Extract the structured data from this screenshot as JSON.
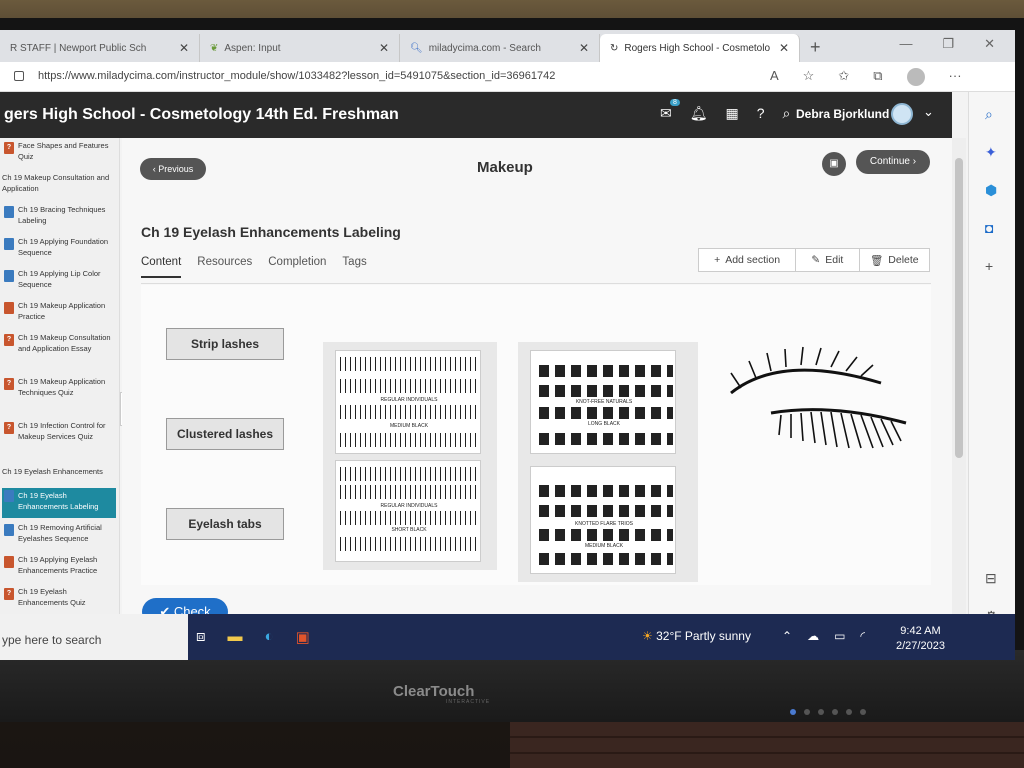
{
  "browser": {
    "tabs": [
      {
        "label": "R STAFF | Newport Public Sch"
      },
      {
        "label": "Aspen: Input"
      },
      {
        "label": "miladycima.com - Search"
      },
      {
        "label": "Rogers High School - Cosmetolo"
      }
    ],
    "url": "https://www.miladycima.com/instructor_module/show/1033482?lesson_id=5491075&section_id=36961742"
  },
  "header": {
    "title": "gers High School - Cosmetology 14th Ed. Freshman",
    "mail_badge": "8",
    "user_name": "Debra Bjorklund"
  },
  "sidebar": {
    "items": [
      {
        "label": "Face Shapes and Features Quiz",
        "icon": "quiz"
      },
      {
        "label": "Ch 19 Makeup Consultation and Application",
        "icon": "none"
      },
      {
        "label": "Ch 19 Bracing Techniques Labeling",
        "icon": "doc"
      },
      {
        "label": "Ch 19 Applying Foundation Sequence",
        "icon": "doc"
      },
      {
        "label": "Ch 19 Applying Lip Color Sequence",
        "icon": "doc"
      },
      {
        "label": "Ch 19 Makeup Application Practice",
        "icon": "practice"
      },
      {
        "label": "Ch 19 Makeup Consultation and Application Essay",
        "icon": "quiz"
      },
      {
        "label": "Ch 19 Makeup Application Techniques Quiz",
        "icon": "quiz"
      },
      {
        "label": "Ch 19 Infection Control for Makeup Services Quiz",
        "icon": "quiz"
      },
      {
        "label": "Ch 19 Eyelash Enhancements",
        "icon": "none"
      },
      {
        "label": "Ch 19 Eyelash Enhancements Labeling",
        "icon": "doc"
      },
      {
        "label": "Ch 19 Removing Artificial Eyelashes Sequence",
        "icon": "doc"
      },
      {
        "label": "Ch 19 Applying Eyelash Enhancements Practice",
        "icon": "practice"
      },
      {
        "label": "Ch 19 Eyelash Enhancements Quiz",
        "icon": "quiz"
      }
    ]
  },
  "main": {
    "previous_label": "Previous",
    "section_title": "Makeup",
    "continue_label": "Continue",
    "page_title": "Ch 19 Eyelash Enhancements Labeling",
    "tabs": [
      "Content",
      "Resources",
      "Completion",
      "Tags"
    ],
    "actions": {
      "add": "Add section",
      "edit": "Edit",
      "delete": "Delete"
    },
    "labels": [
      "Strip lashes",
      "Clustered lashes",
      "Eyelash tabs"
    ],
    "tray_texts": {
      "t1": "REGULAR INDIVIDUALS",
      "t1b": "MEDIUM BLACK",
      "t2": "REGULAR INDIVIDUALS",
      "t2b": "SHORT BLACK",
      "t3": "KNOT-FREE NATURALS",
      "t3b": "LONG BLACK",
      "t4": "KNOTTED FLARE TRIOS",
      "t4b": "MEDIUM BLACK"
    },
    "check_label": "Check"
  },
  "taskbar": {
    "search_placeholder": "ype here to search",
    "weather": "32°F  Partly sunny",
    "time": "9:42 AM",
    "date": "2/27/2023"
  },
  "monitor": {
    "brand": "ClearTouch",
    "brand_sub": "INTERACTIVE"
  }
}
